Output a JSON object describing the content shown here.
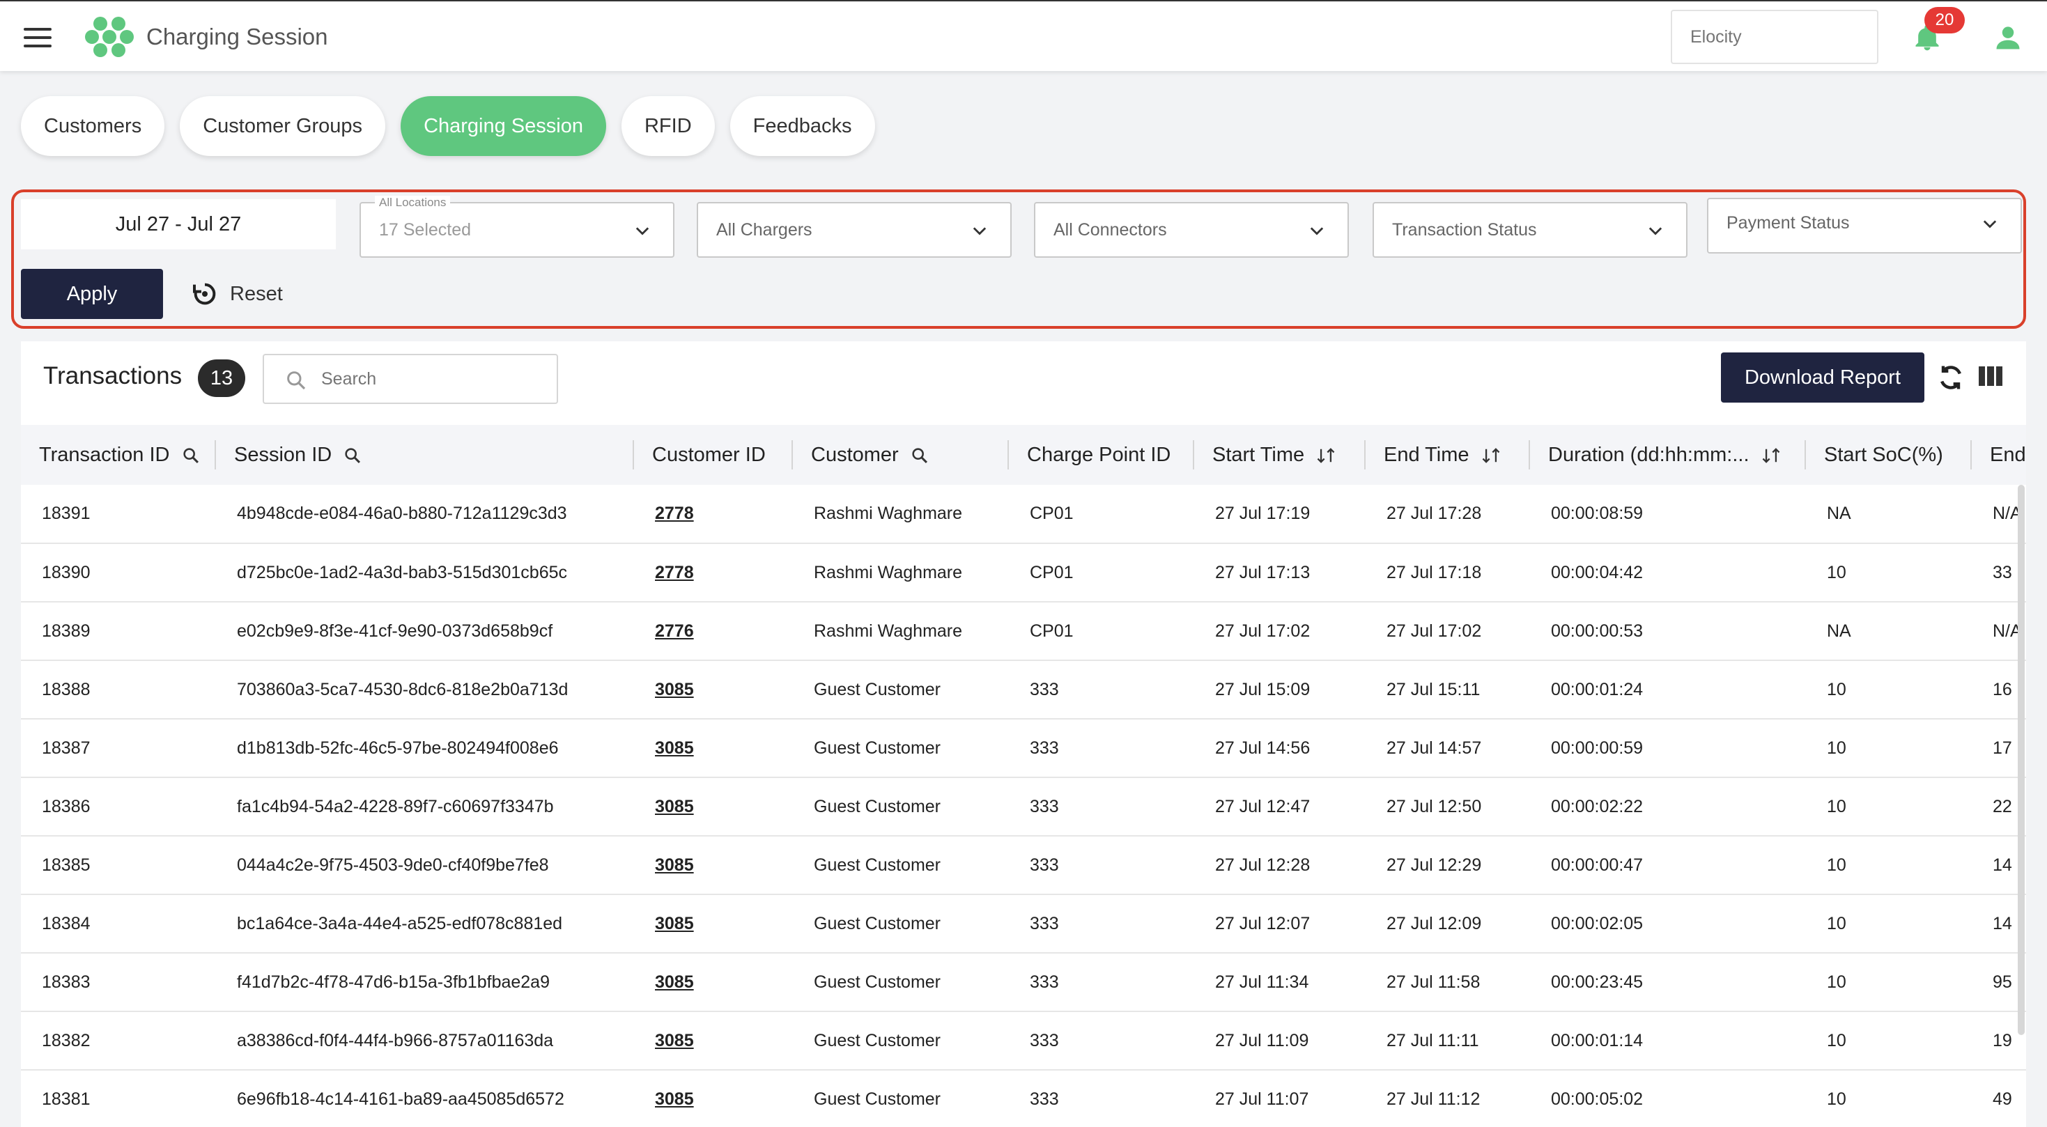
{
  "header": {
    "title": "Charging Session",
    "org_placeholder": "Elocity",
    "notification_count": "20",
    "brand_color": "#5fc77f"
  },
  "tabs": [
    {
      "label": "Customers",
      "active": false
    },
    {
      "label": "Customer Groups",
      "active": false
    },
    {
      "label": "Charging Session",
      "active": true
    },
    {
      "label": "RFID",
      "active": false
    },
    {
      "label": "Feedbacks",
      "active": false
    }
  ],
  "filters": {
    "date_range": "Jul 27 - Jul 27",
    "locations_label": "All Locations",
    "locations_value": "17 Selected",
    "chargers": "All Chargers",
    "connectors": "All Connectors",
    "transaction_status": "Transaction Status",
    "payment_status": "Payment Status",
    "apply_label": "Apply",
    "reset_label": "Reset"
  },
  "transactions": {
    "title": "Transactions",
    "count": "13",
    "search_placeholder": "Search",
    "download_label": "Download Report",
    "columns": [
      "Transaction ID",
      "Session ID",
      "Customer ID",
      "Customer",
      "Charge Point ID",
      "Start Time",
      "End Time",
      "Duration (dd:hh:mm:...",
      "Start SoC(%)",
      "End"
    ],
    "rows": [
      [
        "18391",
        "4b948cde-e084-46a0-b880-712a1129c3d3",
        "2778",
        "Rashmi Waghmare",
        "CP01",
        "27 Jul 17:19",
        "27 Jul 17:28",
        "00:00:08:59",
        "NA",
        "N/A"
      ],
      [
        "18390",
        "d725bc0e-1ad2-4a3d-bab3-515d301cb65c",
        "2778",
        "Rashmi Waghmare",
        "CP01",
        "27 Jul 17:13",
        "27 Jul 17:18",
        "00:00:04:42",
        "10",
        "33"
      ],
      [
        "18389",
        "e02cb9e9-8f3e-41cf-9e90-0373d658b9cf",
        "2776",
        "Rashmi Waghmare",
        "CP01",
        "27 Jul 17:02",
        "27 Jul 17:02",
        "00:00:00:53",
        "NA",
        "N/A"
      ],
      [
        "18388",
        "703860a3-5ca7-4530-8dc6-818e2b0a713d",
        "3085",
        "Guest Customer",
        "333",
        "27 Jul 15:09",
        "27 Jul 15:11",
        "00:00:01:24",
        "10",
        "16"
      ],
      [
        "18387",
        "d1b813db-52fc-46c5-97be-802494f008e6",
        "3085",
        "Guest Customer",
        "333",
        "27 Jul 14:56",
        "27 Jul 14:57",
        "00:00:00:59",
        "10",
        "17"
      ],
      [
        "18386",
        "fa1c4b94-54a2-4228-89f7-c60697f3347b",
        "3085",
        "Guest Customer",
        "333",
        "27 Jul 12:47",
        "27 Jul 12:50",
        "00:00:02:22",
        "10",
        "22"
      ],
      [
        "18385",
        "044a4c2e-9f75-4503-9de0-cf40f9be7fe8",
        "3085",
        "Guest Customer",
        "333",
        "27 Jul 12:28",
        "27 Jul 12:29",
        "00:00:00:47",
        "10",
        "14"
      ],
      [
        "18384",
        "bc1a64ce-3a4a-44e4-a525-edf078c881ed",
        "3085",
        "Guest Customer",
        "333",
        "27 Jul 12:07",
        "27 Jul 12:09",
        "00:00:02:05",
        "10",
        "14"
      ],
      [
        "18383",
        "f41d7b2c-4f78-47d6-b15a-3fb1bfbae2a9",
        "3085",
        "Guest Customer",
        "333",
        "27 Jul 11:34",
        "27 Jul 11:58",
        "00:00:23:45",
        "10",
        "95"
      ],
      [
        "18382",
        "a38386cd-f0f4-44f4-b966-8757a01163da",
        "3085",
        "Guest Customer",
        "333",
        "27 Jul 11:09",
        "27 Jul 11:11",
        "00:00:01:14",
        "10",
        "19"
      ],
      [
        "18381",
        "6e96fb18-4c14-4161-ba89-aa45085d6572",
        "3085",
        "Guest Customer",
        "333",
        "27 Jul 11:07",
        "27 Jul 11:12",
        "00:00:05:02",
        "10",
        "49"
      ]
    ]
  }
}
